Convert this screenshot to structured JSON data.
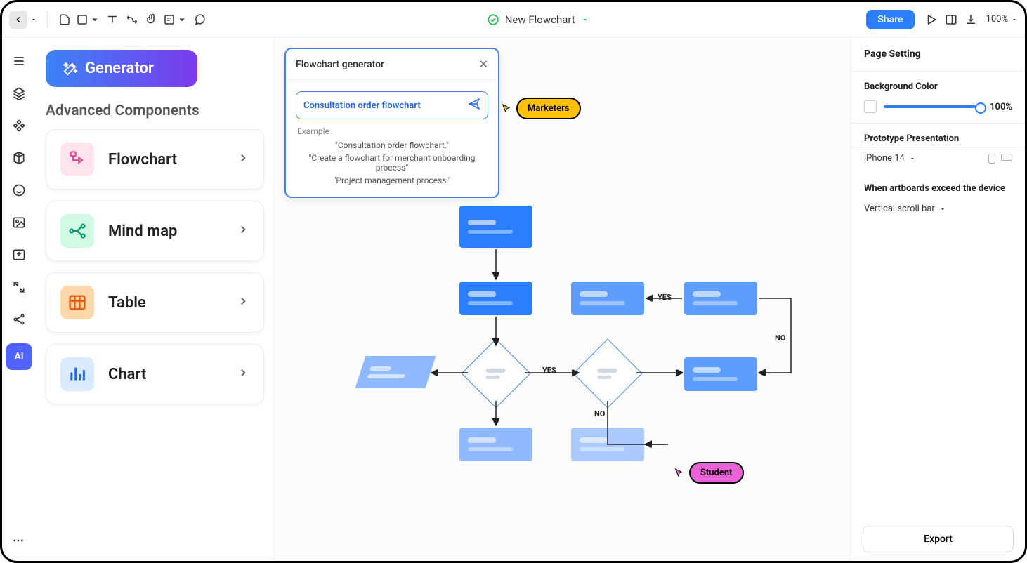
{
  "toolbar": {
    "docTitle": "New Flowchart",
    "shareLabel": "Share",
    "zoomLabel": "100%"
  },
  "leftPanel": {
    "generatorLabel": "Generator",
    "sectionTitle": "Advanced Components",
    "components": [
      {
        "label": "Flowchart"
      },
      {
        "label": "Mind map"
      },
      {
        "label": "Table"
      },
      {
        "label": "Chart"
      }
    ]
  },
  "rail": {
    "aiBadge": "AI"
  },
  "generatorPopup": {
    "title": "Flowchart generator",
    "inputValue": "Consultation order flowchart",
    "exampleLabel": "Example",
    "examples": [
      "\"Consultation order flowchart.\"",
      "\"Create a flowchart for merchant onboarding process\"",
      "\"Project management process.\""
    ]
  },
  "cursors": {
    "marketer": "Marketers",
    "student": "Student"
  },
  "edgeLabels": {
    "yes1": "YES",
    "yes2": "YES",
    "no1": "NO",
    "no2": "NO"
  },
  "rightPanel": {
    "title": "Page Setting",
    "bgLabel": "Background Color",
    "bgPercent": "100%",
    "protoLabel": "Prototype Presentation",
    "device": "iPhone 14",
    "exceedLabel": "When artboards exceed the device",
    "scrollOption": "Vertical scroll bar",
    "exportLabel": "Export"
  }
}
